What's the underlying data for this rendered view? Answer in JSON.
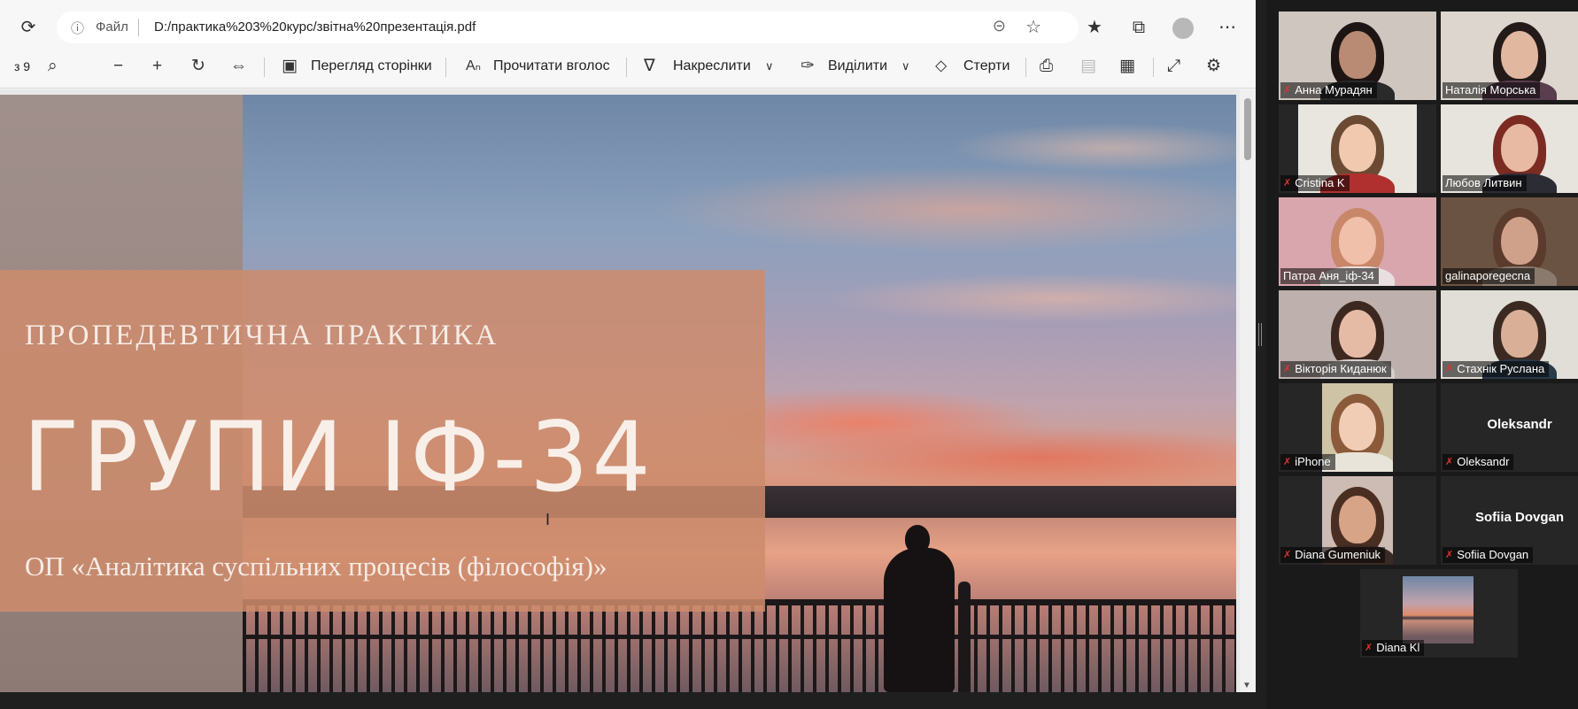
{
  "browser": {
    "address": {
      "info_icon": "info-icon",
      "file_label": "Файл",
      "url": "D:/практика%203%20курс/звітна%20презентація.pdf"
    },
    "pdf_toolbar": {
      "page_of": "з 9",
      "page_view_label": "Перегляд сторінки",
      "read_aloud_label": "Прочитати вголос",
      "draw_label": "Накреслити",
      "highlight_label": "Виділити",
      "erase_label": "Стерти"
    }
  },
  "slide": {
    "subtitle": "ПРОПЕДЕВТИЧНА ПРАКТИКА",
    "title": "ГРУПИ ІФ-34",
    "program": "ОП «Аналітика суспільних процесів (філософія)»"
  },
  "participants": [
    {
      "name": "Анна Мурадян",
      "muted": true,
      "video": true,
      "skin": "#b98a74",
      "hair": "#1c1513",
      "bg": "#cfc6bf",
      "shirt": "#2a2a2a"
    },
    {
      "name": "Наталія Морська",
      "muted": false,
      "video": true,
      "skin": "#e2b7a0",
      "hair": "#231a19",
      "bg": "#dcd6cf",
      "shirt": "#5a3d4e"
    },
    {
      "name": "Cristina K",
      "muted": true,
      "video": true,
      "skin": "#f0c9ae",
      "hair": "#6b4a33",
      "bg": "#e9e6e0",
      "shirt": "#b03030"
    },
    {
      "name": "Любов Литвин",
      "muted": false,
      "video": true,
      "skin": "#e8b9a3",
      "hair": "#7c2b22",
      "bg": "#e7e4de",
      "shirt": "#2c2c34"
    },
    {
      "name": "Патра Аня_іф-34",
      "muted": false,
      "video": true,
      "skin": "#f1c0ab",
      "hair": "#c9876a",
      "bg": "#d9a6ae",
      "shirt": "#e9dfe0",
      "active": true
    },
    {
      "name": "galinaporegecna",
      "muted": false,
      "video": true,
      "skin": "#cfa08a",
      "hair": "#5a3b2c",
      "bg": "#6b5343",
      "shirt": "#8a7a6d"
    },
    {
      "name": "Вікторія Киданюк",
      "muted": true,
      "video": true,
      "skin": "#e6bba6",
      "hair": "#3d2820",
      "bg": "#bdb0ad",
      "shirt": "#d6d0cc"
    },
    {
      "name": "Стахнік Руслана",
      "muted": true,
      "video": true,
      "skin": "#d9b097",
      "hair": "#3a2a22",
      "bg": "#e1ded8",
      "shirt": "#2a3a48"
    },
    {
      "name": "iPhone",
      "muted": true,
      "video": true,
      "skin": "#f2cdb6",
      "hair": "#8b5a3a",
      "bg": "#cfc3a6",
      "shirt": "#e9e4da"
    },
    {
      "name": "Oleksandr",
      "muted": true,
      "video": false
    },
    {
      "name": "Diana Gumeniuk",
      "muted": true,
      "video": true,
      "skin": "#d8a487",
      "hair": "#4a2e22",
      "bg": "#cdbcb3",
      "shirt": "#3a2a26"
    },
    {
      "name": "Sofiia Dovgan",
      "muted": true,
      "video": false
    },
    {
      "name": "Diana Kl",
      "muted": true,
      "video": true,
      "sunset": true
    }
  ]
}
